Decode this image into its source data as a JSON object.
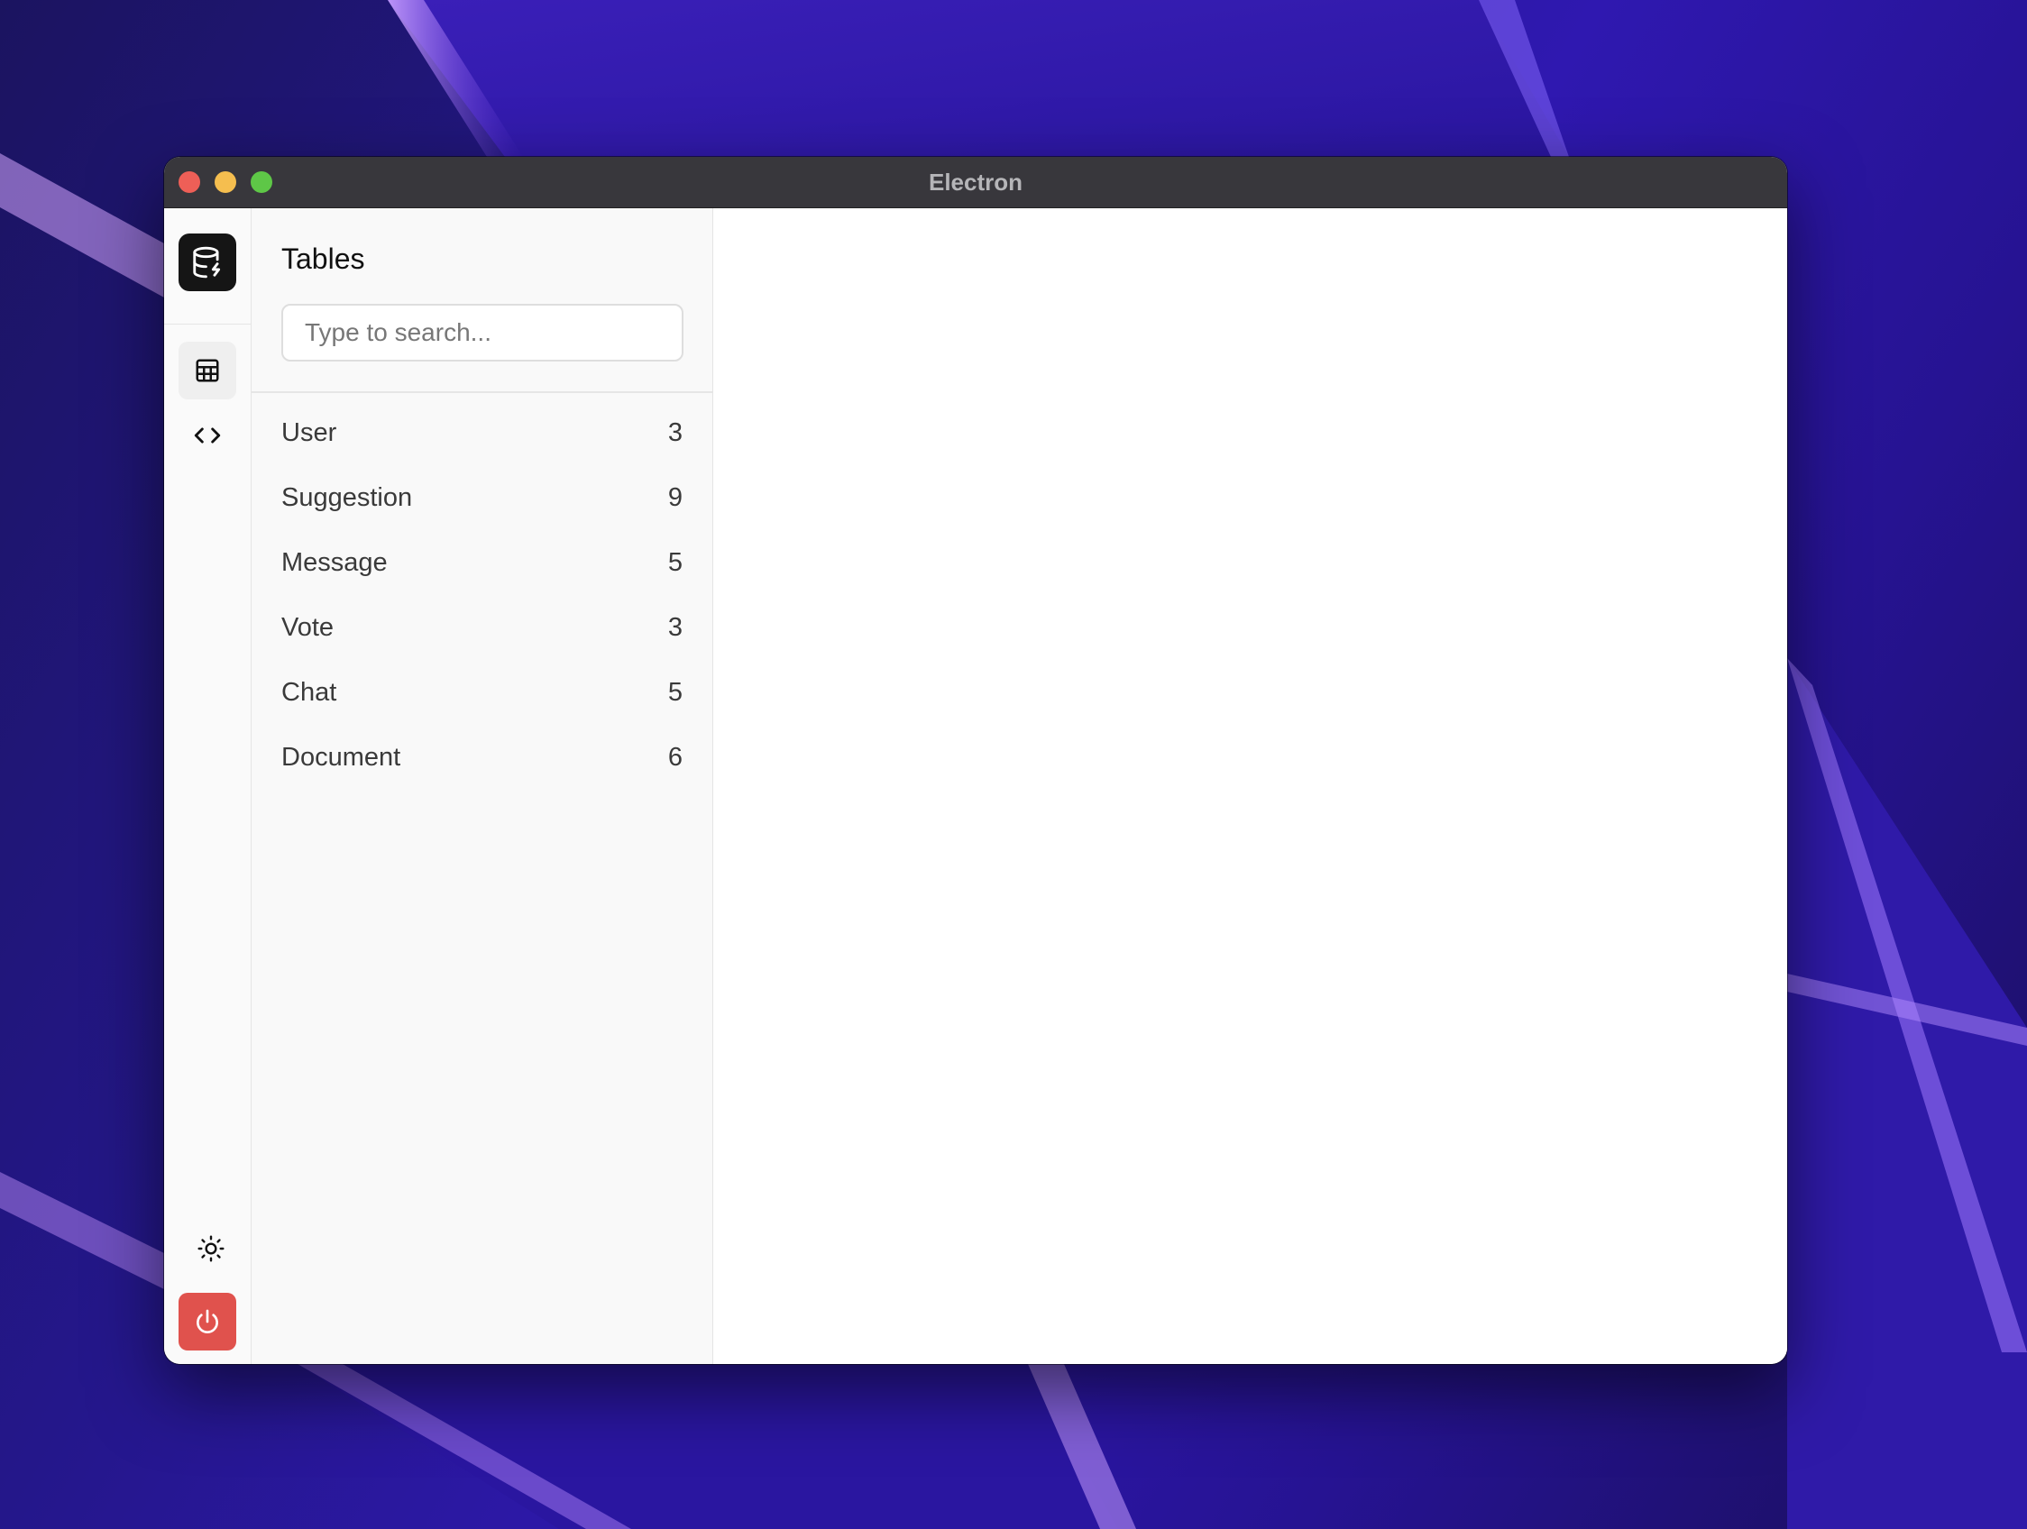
{
  "window": {
    "title": "Electron"
  },
  "icons": {
    "logo": "database-bolt-icon",
    "tables": "table-grid-icon",
    "code": "code-brackets-icon",
    "theme": "sun-icon",
    "power": "power-icon"
  },
  "colors": {
    "titlebar": "#38373c",
    "close": "#ee5f57",
    "minimize": "#f5be4f",
    "zoom": "#5ec747",
    "power_button": "#e0524d",
    "logo_bg": "#151515"
  },
  "sidebar": {
    "title": "Tables",
    "search": {
      "placeholder": "Type to search...",
      "value": ""
    },
    "tables": [
      {
        "name": "User",
        "count": "3"
      },
      {
        "name": "Suggestion",
        "count": "9"
      },
      {
        "name": "Message",
        "count": "5"
      },
      {
        "name": "Vote",
        "count": "3"
      },
      {
        "name": "Chat",
        "count": "5"
      },
      {
        "name": "Document",
        "count": "6"
      }
    ]
  }
}
